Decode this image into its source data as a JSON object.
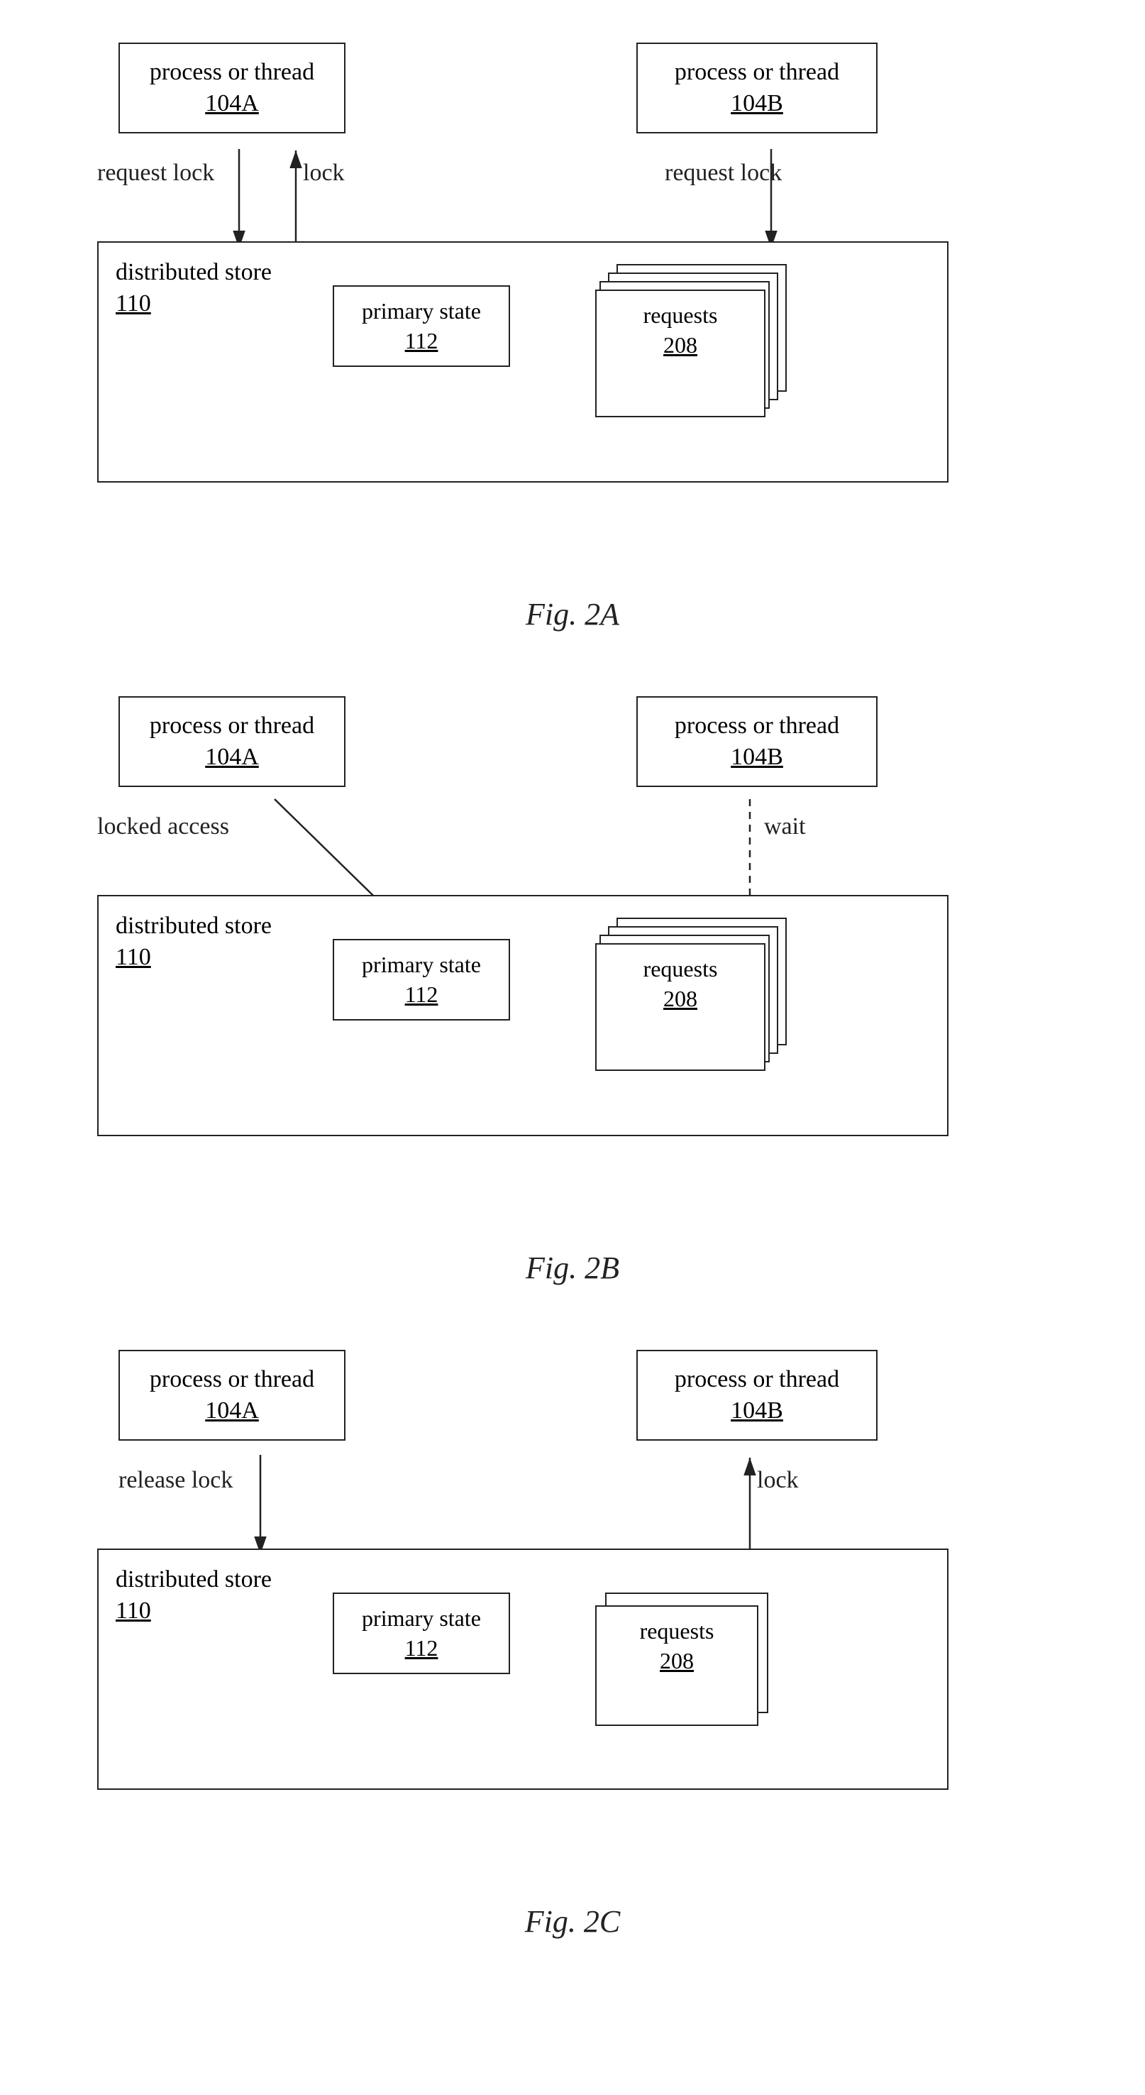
{
  "figures": [
    {
      "id": "fig2a",
      "label": "Fig. 2A",
      "diagrams": {
        "proc_a": {
          "text": "process or thread",
          "id": "104A"
        },
        "proc_b": {
          "text": "process or thread",
          "id": "104B"
        },
        "store": {
          "text": "distributed store",
          "id": "110"
        },
        "primary_state": {
          "text": "primary state",
          "id": "112"
        },
        "requests": {
          "text": "requests",
          "id": "208"
        },
        "arrow_left_label": "request lock",
        "arrow_right_label": "lock",
        "arrow_b_label": "request lock"
      }
    },
    {
      "id": "fig2b",
      "label": "Fig. 2B",
      "diagrams": {
        "proc_a": {
          "text": "process or thread",
          "id": "104A"
        },
        "proc_b": {
          "text": "process or thread",
          "id": "104B"
        },
        "store": {
          "text": "distributed store",
          "id": "110"
        },
        "primary_state": {
          "text": "primary state",
          "id": "112"
        },
        "requests": {
          "text": "requests",
          "id": "208"
        },
        "arrow_a_label": "locked access",
        "arrow_b_label": "wait"
      }
    },
    {
      "id": "fig2c",
      "label": "Fig. 2C",
      "diagrams": {
        "proc_a": {
          "text": "process or thread",
          "id": "104A"
        },
        "proc_b": {
          "text": "process or thread",
          "id": "104B"
        },
        "store": {
          "text": "distributed store",
          "id": "110"
        },
        "primary_state": {
          "text": "primary state",
          "id": "112"
        },
        "requests": {
          "text": "requests",
          "id": "208"
        },
        "arrow_a_label": "release lock",
        "arrow_b_label": "lock"
      }
    }
  ]
}
